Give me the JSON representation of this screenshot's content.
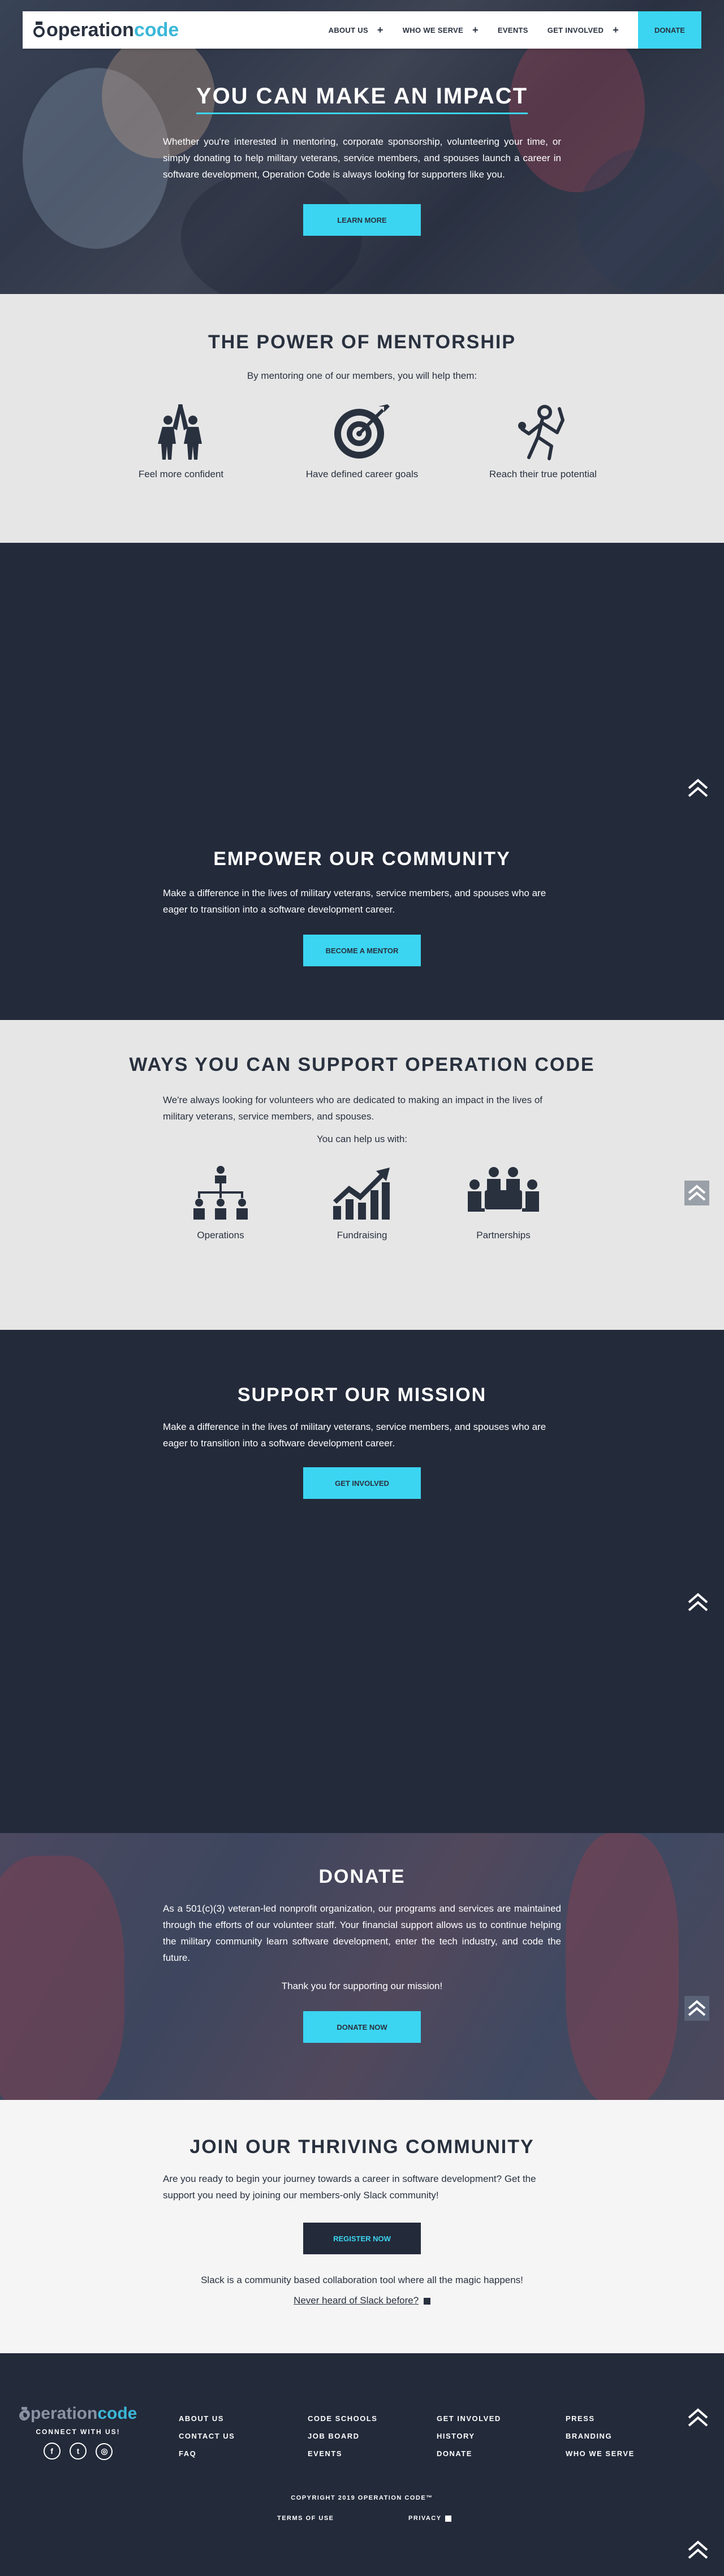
{
  "header": {
    "logo_part1": "operation",
    "logo_part2": "code",
    "nav": [
      {
        "label": "About Us",
        "has_plus": true
      },
      {
        "label": "Who We Serve",
        "has_plus": true
      },
      {
        "label": "Events",
        "has_plus": false
      },
      {
        "label": "Get Involved",
        "has_plus": true
      }
    ],
    "donate_label": "Donate"
  },
  "hero": {
    "title": "You Can Make An Impact",
    "text": "Whether you're interested in mentoring, corporate sponsorship, volunteering your time, or simply donating to help military veterans, service members, and spouses launch a career in software development, Operation Code is always looking for supporters like you.",
    "button": "Learn More"
  },
  "mentorship": {
    "title": "The Power of Mentorship",
    "subtitle": "By mentoring one of our members, you will help them:",
    "items": [
      {
        "label": "Feel more confident",
        "icon": "high-five-icon"
      },
      {
        "label": "Have defined career goals",
        "icon": "target-icon"
      },
      {
        "label": "Reach their true potential",
        "icon": "achievement-icon"
      }
    ]
  },
  "empower": {
    "title": "Empower Our Community",
    "text": "Make a difference in the lives of military veterans, service members, and spouses who are eager to transition into a software development career.",
    "button": "Become a Mentor"
  },
  "ways": {
    "title": "Ways You Can Support Operation Code",
    "text": "We're always looking for volunteers who are dedicated to making an impact in the lives of military veterans, service members, and spouses.",
    "subtitle": "You can help us with:",
    "items": [
      {
        "label": "Operations",
        "icon": "org-chart-icon"
      },
      {
        "label": "Fundraising",
        "icon": "growth-chart-icon"
      },
      {
        "label": "Partnerships",
        "icon": "meeting-icon"
      }
    ]
  },
  "mission": {
    "title": "Support Our Mission",
    "text": "Make a difference in the lives of military veterans, service members, and spouses who are eager to transition into a software development career.",
    "button": "Get Involved"
  },
  "donate": {
    "title": "Donate",
    "text": "As a 501(c)(3) veteran-led nonprofit organization, our programs and services are maintained through the efforts of our volunteer staff. Your financial support allows us to continue helping the military community learn software development, enter the tech industry, and code the future.",
    "thanks": "Thank you for supporting our mission!",
    "button": "Donate Now"
  },
  "join": {
    "title": "Join Our Thriving Community",
    "text": "Are you ready to begin your journey towards a career in software development? Get the support you need by joining our members-only Slack community!",
    "button": "Register Now",
    "slack_text": "Slack is a community based collaboration tool where all the magic happens!",
    "slack_link": "Never heard of Slack before?"
  },
  "footer": {
    "logo_part1": "operation",
    "logo_part2": "code",
    "connect": "Connect With Us!",
    "col1": [
      "About Us",
      "Contact Us",
      "FAQ"
    ],
    "col2": [
      "Code Schools",
      "Job Board",
      "Events"
    ],
    "col3": [
      "Get Involved",
      "History",
      "Donate"
    ],
    "col4": [
      "Press",
      "Branding",
      "Who We Serve"
    ],
    "copyright": "Copyright 2019 Operation Code™",
    "terms": "Terms of Use",
    "privacy": "Privacy"
  },
  "colors": {
    "navy": "#232a3a",
    "cyan": "#3bd5f1",
    "light_gray": "#e6e6e6",
    "text_dark": "#29313f"
  }
}
